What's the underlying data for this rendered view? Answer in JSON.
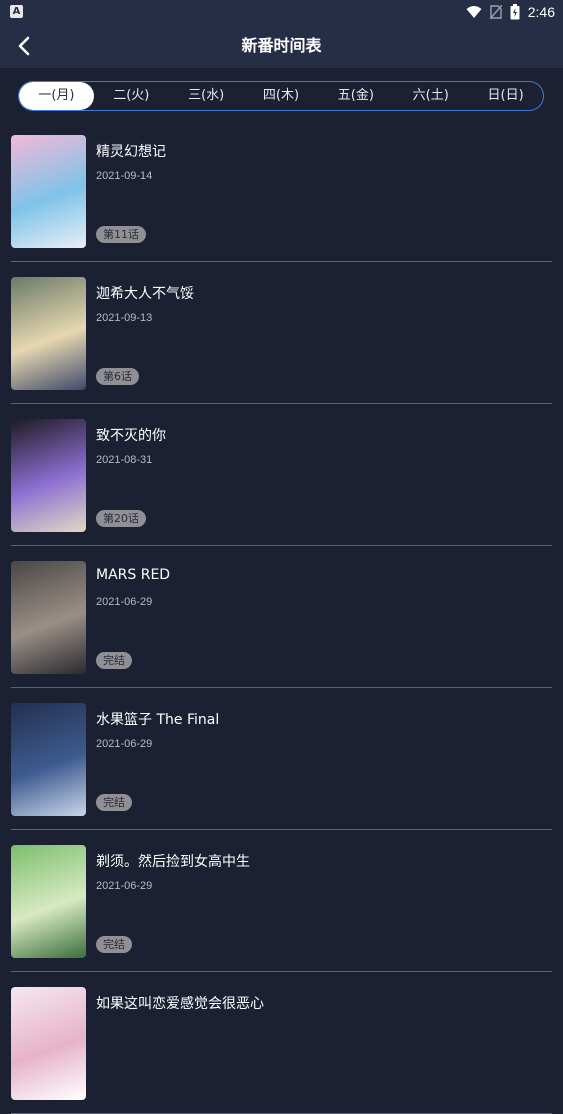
{
  "status_bar": {
    "time": "2:46",
    "app_icon_letter": "A",
    "icons": [
      "wifi-icon",
      "no-sim-icon",
      "battery-icon"
    ]
  },
  "header": {
    "title": "新番时间表",
    "back_icon": "chevron-left-icon"
  },
  "tabs": [
    {
      "label": "一(月)",
      "active": true
    },
    {
      "label": "二(火)",
      "active": false
    },
    {
      "label": "三(水)",
      "active": false
    },
    {
      "label": "四(木)",
      "active": false
    },
    {
      "label": "五(金)",
      "active": false
    },
    {
      "label": "六(土)",
      "active": false
    },
    {
      "label": "日(日)",
      "active": false
    }
  ],
  "items": [
    {
      "title": "精灵幻想记",
      "date": "2021-09-14",
      "badge": "第11话",
      "thumb_colors": [
        "#f2b8d8",
        "#7fc3e8",
        "#e9eef7"
      ]
    },
    {
      "title": "迦希大人不气馁",
      "date": "2021-09-13",
      "badge": "第6话",
      "thumb_colors": [
        "#6b7a68",
        "#e6d7b0",
        "#3f4a6b"
      ]
    },
    {
      "title": "致不灭的你",
      "date": "2021-08-31",
      "badge": "第20话",
      "thumb_colors": [
        "#1e1a24",
        "#8c6fd1",
        "#e2d9c4"
      ]
    },
    {
      "title": "MARS RED",
      "date": "2021-06-29",
      "badge": "完结",
      "thumb_colors": [
        "#4a4646",
        "#9a8f86",
        "#2a2a30"
      ]
    },
    {
      "title": "水果篮子 The Final",
      "date": "2021-06-29",
      "badge": "完结",
      "thumb_colors": [
        "#22304f",
        "#3e5b8f",
        "#c9d6ea"
      ]
    },
    {
      "title": "剃须。然后捡到女高中生",
      "date": "2021-06-29",
      "badge": "完结",
      "thumb_colors": [
        "#7bbf6a",
        "#d8e9c4",
        "#3b6e3a"
      ]
    },
    {
      "title": "如果这叫恋爱感觉会很恶心",
      "date": "",
      "badge": "",
      "thumb_colors": [
        "#f6e7ef",
        "#e6b3c9",
        "#ffffff"
      ]
    }
  ]
}
